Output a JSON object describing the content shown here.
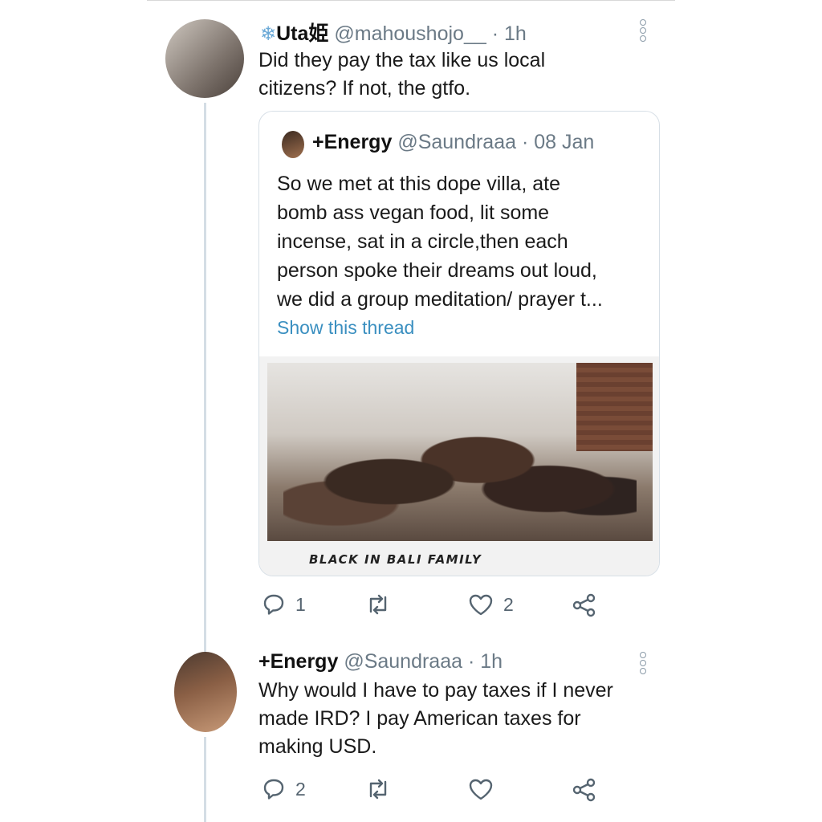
{
  "tweet1": {
    "display_name": "Uta姫",
    "handle": "@mahoushojo__",
    "time": "· 1h",
    "text_line1": "Did they pay the tax like us local",
    "text_line2": "citizens? If not, the gtfo."
  },
  "quoted": {
    "display_name": "+Energy",
    "handle": "@Saundraaa",
    "time": "· 08 Jan",
    "text_lines": [
      "So we met at this dope villa, ate",
      "bomb ass vegan food, lit some",
      "incense, sat in a circle,then each",
      "person spoke their dreams out loud,",
      "we did a group meditation/ prayer t..."
    ],
    "show_thread": "Show this thread",
    "photo_caption": "BLACK IN BALI FAMILY"
  },
  "tweet1_actions": {
    "replies": "1",
    "retweets": "",
    "likes": "2"
  },
  "tweet2": {
    "display_name": "+Energy",
    "handle": "@Saundraaa",
    "time": "· 1h",
    "text_line1": "Why would I have to pay taxes if I never",
    "text_line2": "made IRD? I pay American taxes for",
    "text_line3": "making USD."
  },
  "tweet2_actions": {
    "replies": "2",
    "retweets": "",
    "likes": ""
  },
  "icons": {
    "snowflake": "snowflake-icon",
    "reply": "reply-icon",
    "retweet": "retweet-icon",
    "like": "like-icon",
    "share": "share-icon",
    "menu": "more-icon"
  },
  "colors": {
    "link": "#3a8fc0",
    "handle": "#6b7a86",
    "icon": "#556470",
    "snowflake": "#69a8d6"
  }
}
